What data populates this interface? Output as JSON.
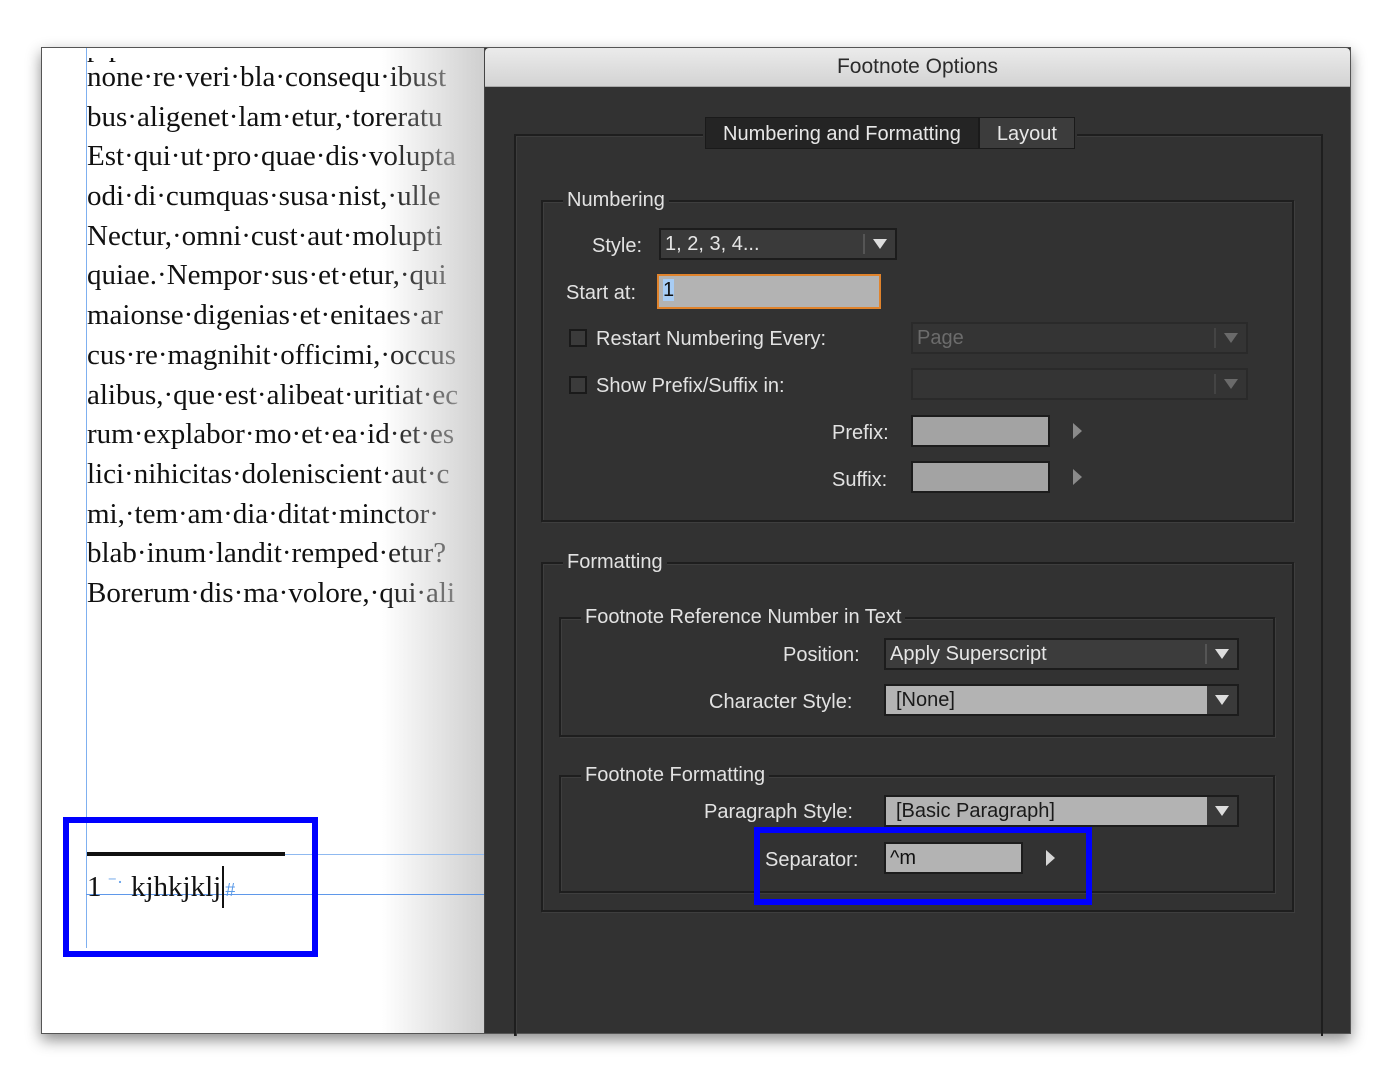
{
  "document": {
    "body_lines": [
      "none·re·veri·bla·consequ·ibust",
      "bus·aligenet·lam·etur,·toreratu",
      "Est·qui·ut·pro·quae·dis·volupta",
      "odi·di·cumquas·susa·nist,·ulle",
      "Nectur,·omni·cust·aut·molupti",
      "quiae.·Nempor·sus·et·etur,·qui",
      "maionse·digenias·et·enitaes·ar",
      "cus·re·magnihit·officimi,·occus",
      "alibus,·que·est·alibeat·uritiat·ec",
      "rum·explabor·mo·et·ea·id·et·es",
      "lici·nihicitas·doleniscient·aut·c",
      "mi,·tem·am·dia·ditat·minctor·",
      "blab·inum·landit·remped·etur?",
      "Borerum·dis·ma·volore,·qui·ali"
    ],
    "partial_top_line": "    p                          p",
    "footnote": {
      "number": "1",
      "separator_glyph": "⁻·",
      "text": "kjhkjklj",
      "end_marker": "#"
    }
  },
  "dialog": {
    "title": "Footnote Options",
    "tabs": [
      {
        "label": "Numbering and Formatting",
        "active": true
      },
      {
        "label": "Layout",
        "active": false
      }
    ],
    "numbering": {
      "group_label": "Numbering",
      "style_label": "Style:",
      "style_value": "1, 2, 3, 4...",
      "start_at_label": "Start at:",
      "start_at_value": "1",
      "restart_label": "Restart Numbering Every:",
      "restart_checked": false,
      "restart_value": "Page",
      "show_prefix_label": "Show Prefix/Suffix in:",
      "show_prefix_checked": false,
      "show_prefix_value": "",
      "prefix_label": "Prefix:",
      "prefix_value": "",
      "suffix_label": "Suffix:",
      "suffix_value": ""
    },
    "formatting": {
      "group_label": "Formatting",
      "reference": {
        "group_label": "Footnote Reference Number in Text",
        "position_label": "Position:",
        "position_value": "Apply Superscript",
        "char_style_label": "Character Style:",
        "char_style_value": "[None]"
      },
      "footnote_formatting": {
        "group_label": "Footnote Formatting",
        "para_style_label": "Paragraph Style:",
        "para_style_value": "[Basic Paragraph]",
        "separator_label": "Separator:",
        "separator_value": "^m"
      }
    }
  },
  "annotations": {
    "highlight_color": "#0000ff"
  }
}
